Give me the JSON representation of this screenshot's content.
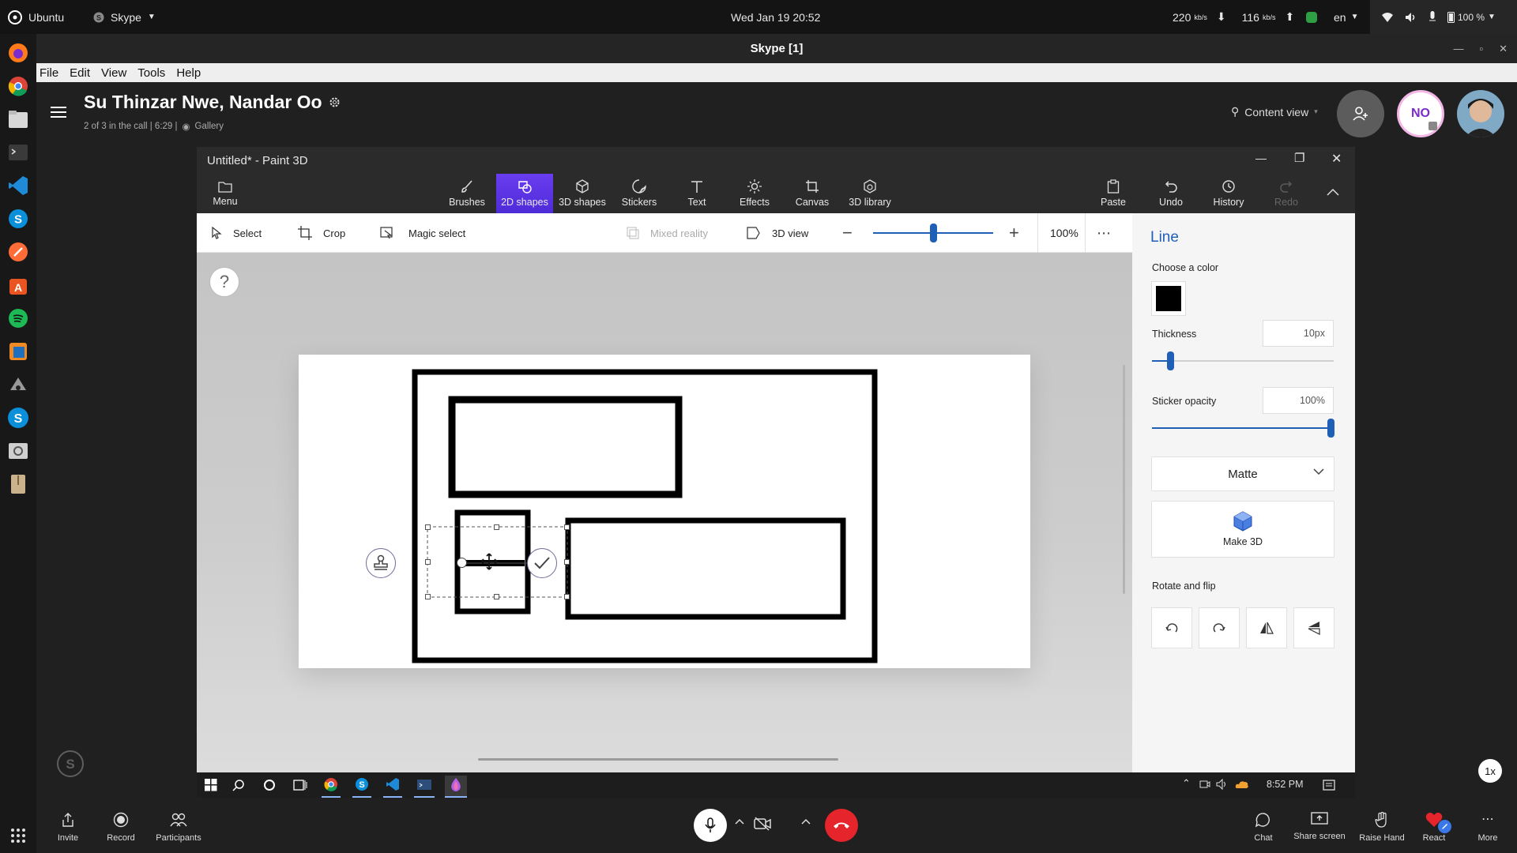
{
  "gnome": {
    "activities": "Ubuntu",
    "app": "Skype",
    "datetime": "Wed Jan 19  20:52",
    "down_speed": "220",
    "down_unit": "kb/s",
    "up_speed": "116",
    "up_unit": "kb/s",
    "lang": "en",
    "battery": "100 %"
  },
  "skype": {
    "window_title": "Skype [1]",
    "menu": [
      "File",
      "Edit",
      "View",
      "Tools",
      "Help"
    ],
    "call_title": "Su Thinzar Nwe, Nandar Oo",
    "call_sub": "2 of 3 in the call | 6:29 |",
    "call_view": "Gallery",
    "content_view": "Content view",
    "participant_initials": "NO",
    "speed_badge": "1x",
    "bottom_left": [
      {
        "label": "Invite",
        "icon": "share-icon"
      },
      {
        "label": "Record",
        "icon": "record-icon"
      },
      {
        "label": "Participants",
        "icon": "participants-icon"
      }
    ],
    "bottom_right": [
      {
        "label": "Chat",
        "icon": "chat-icon"
      },
      {
        "label": "Share screen",
        "icon": "share-screen-icon"
      },
      {
        "label": "Raise Hand",
        "icon": "raise-hand-icon"
      },
      {
        "label": "React",
        "icon": "heart-icon"
      },
      {
        "label": "More",
        "icon": "more-icon"
      }
    ]
  },
  "paint3d": {
    "title": "Untitled* - Paint 3D",
    "menu_label": "Menu",
    "tools": [
      {
        "label": "Brushes",
        "icon": "brush-icon"
      },
      {
        "label": "2D shapes",
        "icon": "2d-shapes-icon",
        "active": true
      },
      {
        "label": "3D shapes",
        "icon": "3d-shapes-icon"
      },
      {
        "label": "Stickers",
        "icon": "stickers-icon"
      },
      {
        "label": "Text",
        "icon": "text-icon"
      },
      {
        "label": "Effects",
        "icon": "effects-icon"
      },
      {
        "label": "Canvas",
        "icon": "canvas-icon"
      },
      {
        "label": "3D library",
        "icon": "3d-library-icon"
      }
    ],
    "actions": [
      {
        "label": "Paste",
        "icon": "paste-icon"
      },
      {
        "label": "Undo",
        "icon": "undo-icon"
      },
      {
        "label": "History",
        "icon": "history-icon"
      },
      {
        "label": "Redo",
        "icon": "redo-icon",
        "disabled": true
      }
    ],
    "subbar": {
      "select": "Select",
      "crop": "Crop",
      "magic_select": "Magic select",
      "mixed_reality": "Mixed reality",
      "view_3d": "3D view",
      "zoom": "100%",
      "zoom_level": 0.5
    },
    "help": "?",
    "panel": {
      "title": "Line",
      "choose_color": "Choose a color",
      "color": "#000000",
      "thickness_label": "Thickness",
      "thickness_value": "10px",
      "thickness_level": 0.1,
      "opacity_label": "Sticker opacity",
      "opacity_value": "100%",
      "opacity_level": 1.0,
      "finish": "Matte",
      "make3d": "Make 3D",
      "rotate_flip": "Rotate and flip"
    }
  },
  "win_taskbar": {
    "time": "8:52 PM"
  },
  "colors": {
    "accent_purple": "#5b34e0",
    "paint_blue": "#1f5fb5",
    "hangup_red": "#e5242b"
  }
}
